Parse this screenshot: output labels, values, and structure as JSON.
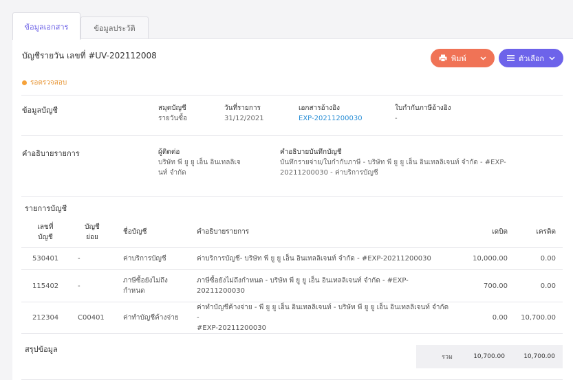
{
  "tabs": [
    {
      "label": "ข้อมูลเอกสาร",
      "active": true
    },
    {
      "label": "ข้อมูลประวัติ",
      "active": false
    }
  ],
  "document": {
    "title": "บัญชีรายวัน เลขที่ #UV-202112008",
    "status": "รอตรวจสอบ",
    "status_color": "#f6a23a"
  },
  "buttons": {
    "print": {
      "label": "พิมพ์",
      "icon": "printer-icon",
      "color": "#f07356"
    },
    "options": {
      "label": "ตัวเลือก",
      "icon": "menu-icon",
      "color": "#6d63ea"
    }
  },
  "account_info": {
    "section_label": "ข้อมูลบัญชี",
    "fields": [
      {
        "label": "สมุดบัญชี",
        "value": "รายวันซื้อ"
      },
      {
        "label": "วันที่รายการ",
        "value": "31/12/2021"
      },
      {
        "label": "เอกสารอ้างอิง",
        "value": "EXP-20211200030"
      },
      {
        "label": "ใบกำกับภาษีอ้างอิง",
        "value": "-"
      }
    ]
  },
  "description": {
    "section_label": "คำอธิบายรายการ",
    "contact_label": "ผู้ติดต่อ",
    "contact_value_1": "บริษัท พี ยู ยู เอ็น อินเทลลิเจ",
    "contact_value_2": "นท์ จำกัด",
    "note_label": "คำอธิบายบันทึกบัญชี",
    "note_value_1": "บันทึกรายจ่าย/ใบกำกับภาษี - บริษัท พี ยู ยู เอ็น อินเทลลิเจนท์ จำกัด - #EXP-",
    "note_value_2": "20211200030 - ค่าบริการบัญชี"
  },
  "ledger": {
    "section_label": "รายการบัญชี",
    "headers": {
      "account_no_1": "เลขที่",
      "account_no_2": "บัญชี",
      "sub_account_1": "บัญชี",
      "sub_account_2": "ย่อย",
      "account_name": "ชื่อบัญชี",
      "description": "คำอธิบายรายการ",
      "debit": "เดบิต",
      "credit": "เครดิต"
    },
    "rows": [
      {
        "account_no": "530401",
        "sub_account": "-",
        "name_1": "ค่าบริการบัญชี",
        "name_2": "",
        "desc_1": "ค่าบริการบัญชี- บริษัท พี ยู ยู เอ็น อินเทลลิเจนท์ จำกัด - #EXP-20211200030",
        "desc_2": "",
        "debit": "10,000.00",
        "credit": "0.00"
      },
      {
        "account_no": "115402",
        "sub_account": "-",
        "name_1": "ภาษีซื้อยังไม่ถึง",
        "name_2": "กำหนด",
        "desc_1": "ภาษีซื้อยังไม่ถึงกำหนด - บริษัท พี ยู ยู เอ็น อินเทลลิเจนท์ จำกัด - #EXP-20211200030",
        "desc_2": "",
        "debit": "700.00",
        "credit": "0.00"
      },
      {
        "account_no": "212304",
        "sub_account": "C00401",
        "name_1": "ค่าทำบัญชีค้างจ่าย",
        "name_2": "",
        "desc_1": "ค่าทำบัญชีค้างจ่าย - พี ยู ยู เอ็น อินเทลลิเจนท์ - บริษัท พี ยู ยู เอ็น อินเทลลิเจนท์ จำกัด -",
        "desc_2": "#EXP-20211200030",
        "debit": "0.00",
        "credit": "10,700.00"
      }
    ]
  },
  "summary": {
    "section_label": "สรุปข้อมูล",
    "total_label": "รวม",
    "total_debit": "10,700.00",
    "total_credit": "10,700.00"
  }
}
